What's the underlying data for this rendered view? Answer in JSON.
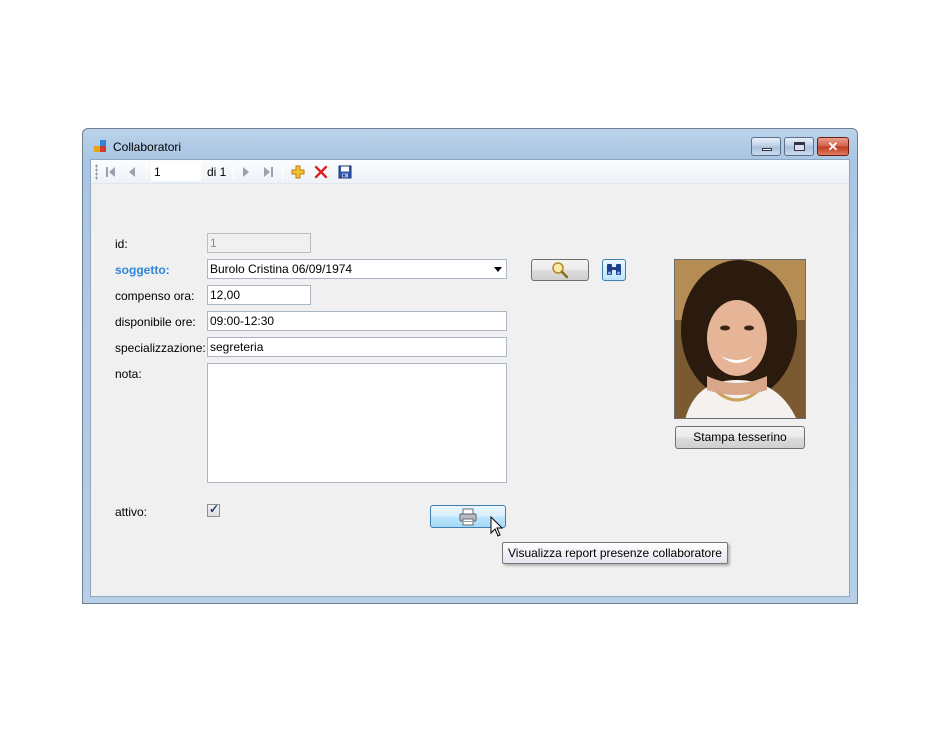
{
  "window": {
    "title": "Collaboratori"
  },
  "toolbar": {
    "position_value": "1",
    "count_label": "di 1",
    "icons": [
      "move-first-icon",
      "move-previous-icon",
      "move-next-icon",
      "move-last-icon",
      "add-new-icon",
      "delete-icon",
      "save-icon"
    ]
  },
  "form": {
    "id_label": "id:",
    "id_value": "1",
    "soggetto_label": "soggetto:",
    "soggetto_value": "Burolo Cristina 06/09/1974",
    "compenso_label": "compenso ora:",
    "compenso_value": "12,00",
    "disponibile_label": "disponibile ore:",
    "disponibile_value": "09:00-12:30",
    "specializzazione_label": "specializzazione:",
    "specializzazione_value": "segreteria",
    "nota_label": "nota:",
    "nota_value": "",
    "attivo_label": "attivo:",
    "attivo_checked": true
  },
  "buttons": {
    "stampa_label": "Stampa tesserino"
  },
  "tooltip": {
    "text": "Visualizza report presenze collaboratore"
  },
  "colors": {
    "accent_label": "#2f86d8",
    "delete": "#e02020",
    "add": "#e8a317"
  }
}
